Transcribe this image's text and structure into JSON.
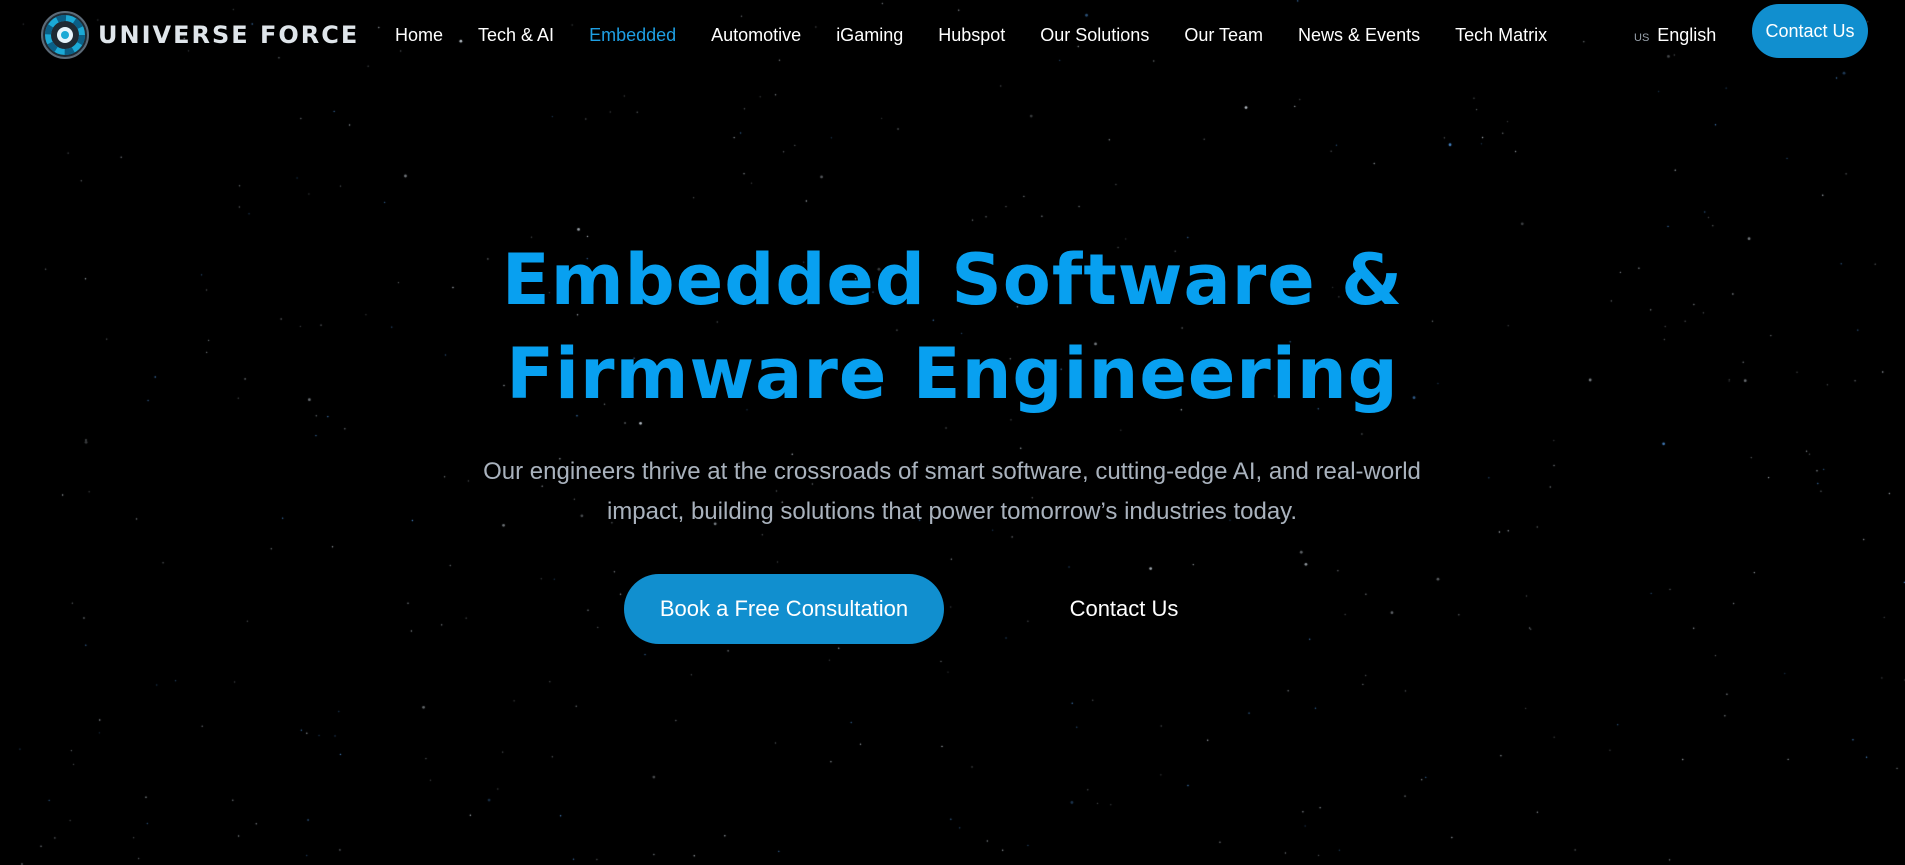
{
  "brand": {
    "name": "UNIVERSE FORCE",
    "logo_icon": "universe-force-logo-icon",
    "accent_color": "#08a0f0",
    "button_color": "#118fcf",
    "background_color": "#000000"
  },
  "nav": {
    "items": [
      {
        "label": "Home",
        "active": false
      },
      {
        "label": "Tech & AI",
        "active": false
      },
      {
        "label": "Embedded",
        "active": true
      },
      {
        "label": "Automotive",
        "active": false
      },
      {
        "label": "iGaming",
        "active": false
      },
      {
        "label": "Hubspot",
        "active": false
      },
      {
        "label": "Our Solutions",
        "active": false
      },
      {
        "label": "Our Team",
        "active": false
      },
      {
        "label": "News & Events",
        "active": false
      },
      {
        "label": "Tech Matrix",
        "active": false
      }
    ]
  },
  "language": {
    "flag": "US",
    "label": "English"
  },
  "header_cta": {
    "label": "Contact Us"
  },
  "hero": {
    "title_line1": "Embedded Software &",
    "title_line2": "Firmware Engineering",
    "description": "Our engineers thrive at the crossroads of smart software, cutting-edge AI, and real-world impact, building solutions that power tomorrow’s industries today.",
    "primary_button": "Book a Free Consultation",
    "secondary_button": "Contact Us"
  }
}
